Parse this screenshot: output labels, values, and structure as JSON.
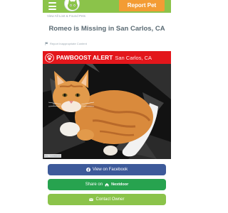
{
  "header": {
    "report_label": "Report Pet",
    "brand_color": "#8bc34a",
    "report_color": "#f39c34"
  },
  "breadcrumb": "View All Lost & Found Pets",
  "page": {
    "title": "Romeo is Missing in San Carlos, CA"
  },
  "report_link": "Report Inappropriate Content",
  "alert": {
    "title": "PAWBOOST ALERT",
    "location": "San Carlos, CA",
    "color": "#e3161b"
  },
  "photo": {
    "id_label": "ID: 7226645"
  },
  "buttons": {
    "facebook": "View on Facebook",
    "nextdoor_prefix": "Share on",
    "nextdoor_brand": "Nextdoor",
    "contact": "Contact Owner"
  }
}
